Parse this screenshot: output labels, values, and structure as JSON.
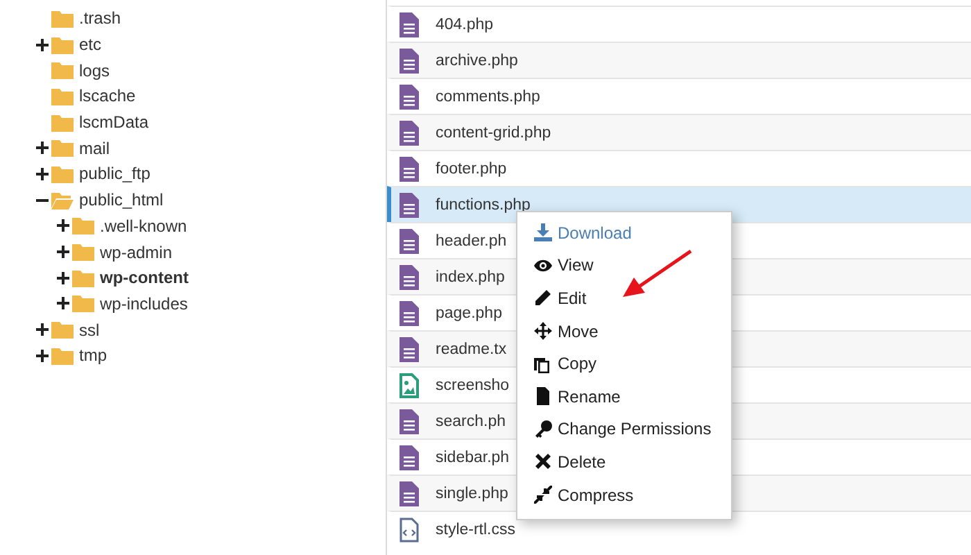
{
  "tree": [
    {
      "name": ".trash",
      "expandable": false,
      "expanded": false,
      "selected": false
    },
    {
      "name": "etc",
      "expandable": true,
      "expanded": false,
      "selected": false
    },
    {
      "name": "logs",
      "expandable": false,
      "expanded": false,
      "selected": false
    },
    {
      "name": "lscache",
      "expandable": false,
      "expanded": false,
      "selected": false
    },
    {
      "name": "lscmData",
      "expandable": false,
      "expanded": false,
      "selected": false
    },
    {
      "name": "mail",
      "expandable": true,
      "expanded": false,
      "selected": false
    },
    {
      "name": "public_ftp",
      "expandable": true,
      "expanded": false,
      "selected": false
    },
    {
      "name": "public_html",
      "expandable": true,
      "expanded": true,
      "selected": false,
      "children": [
        {
          "name": ".well-known",
          "expandable": true,
          "expanded": false,
          "selected": false
        },
        {
          "name": "wp-admin",
          "expandable": true,
          "expanded": false,
          "selected": false
        },
        {
          "name": "wp-content",
          "expandable": true,
          "expanded": false,
          "selected": true
        },
        {
          "name": "wp-includes",
          "expandable": true,
          "expanded": false,
          "selected": false
        }
      ]
    },
    {
      "name": "ssl",
      "expandable": true,
      "expanded": false,
      "selected": false
    },
    {
      "name": "tmp",
      "expandable": true,
      "expanded": false,
      "selected": false
    }
  ],
  "files": [
    {
      "name": "404.php",
      "kind": "text",
      "selected": false
    },
    {
      "name": "archive.php",
      "kind": "text",
      "selected": false
    },
    {
      "name": "comments.php",
      "kind": "text",
      "selected": false
    },
    {
      "name": "content-grid.php",
      "kind": "text",
      "selected": false
    },
    {
      "name": "footer.php",
      "kind": "text",
      "selected": false
    },
    {
      "name": "functions.php",
      "kind": "text",
      "selected": true
    },
    {
      "name": "header.ph",
      "kind": "text",
      "selected": false
    },
    {
      "name": "index.php",
      "kind": "text",
      "selected": false
    },
    {
      "name": "page.php",
      "kind": "text",
      "selected": false
    },
    {
      "name": "readme.tx",
      "kind": "text",
      "selected": false
    },
    {
      "name": "screensho",
      "kind": "image",
      "selected": false
    },
    {
      "name": "search.ph",
      "kind": "text",
      "selected": false
    },
    {
      "name": "sidebar.ph",
      "kind": "text",
      "selected": false
    },
    {
      "name": "single.php",
      "kind": "text",
      "selected": false
    },
    {
      "name": "style-rtl.css",
      "kind": "code",
      "selected": false
    }
  ],
  "context_menu": [
    {
      "label": "Download",
      "highlighted": true
    },
    {
      "label": "View",
      "highlighted": false
    },
    {
      "label": "Edit",
      "highlighted": false
    },
    {
      "label": "Move",
      "highlighted": false
    },
    {
      "label": "Copy",
      "highlighted": false
    },
    {
      "label": "Rename",
      "highlighted": false
    },
    {
      "label": "Change Permissions",
      "highlighted": false
    },
    {
      "label": "Delete",
      "highlighted": false
    },
    {
      "label": "Compress",
      "highlighted": false
    }
  ],
  "annotation": {
    "kind": "arrow"
  }
}
